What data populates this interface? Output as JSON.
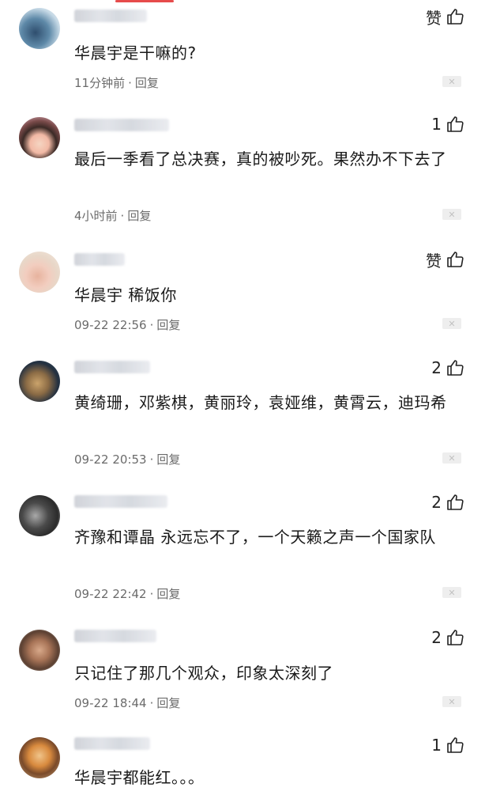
{
  "comments": [
    {
      "text": "华晨宇是干嘛的?",
      "time": "11分钟前",
      "reply": "回复",
      "likes": "赞"
    },
    {
      "text": "最后一季看了总决赛，真的被吵死。果然办不下去了",
      "time": "4小时前",
      "reply": "回复",
      "likes": "1"
    },
    {
      "text": "华晨宇 稀饭你",
      "time": "09-22 22:56",
      "reply": "回复",
      "likes": "赞"
    },
    {
      "text": "黄绮珊，邓紫棋，黄丽玲，袁娅维，黄霄云，迪玛希",
      "time": "09-22 20:53",
      "reply": "回复",
      "likes": "2"
    },
    {
      "text": "齐豫和谭晶 永远忘不了，一个天籁之声一个国家队",
      "time": "09-22 22:42",
      "reply": "回复",
      "likes": "2"
    },
    {
      "text": "只记住了那几个观众，印象太深刻了",
      "time": "09-22 18:44",
      "reply": "回复",
      "likes": "2"
    },
    {
      "text": "华晨宇都能红。。。",
      "time": "",
      "reply": "",
      "likes": "1"
    }
  ],
  "ui": {
    "separator": "·",
    "close_glyph": "✕"
  },
  "colors": {
    "accent": "#e64b4b",
    "text": "#1a1a1a",
    "meta": "#6b6b6b"
  }
}
